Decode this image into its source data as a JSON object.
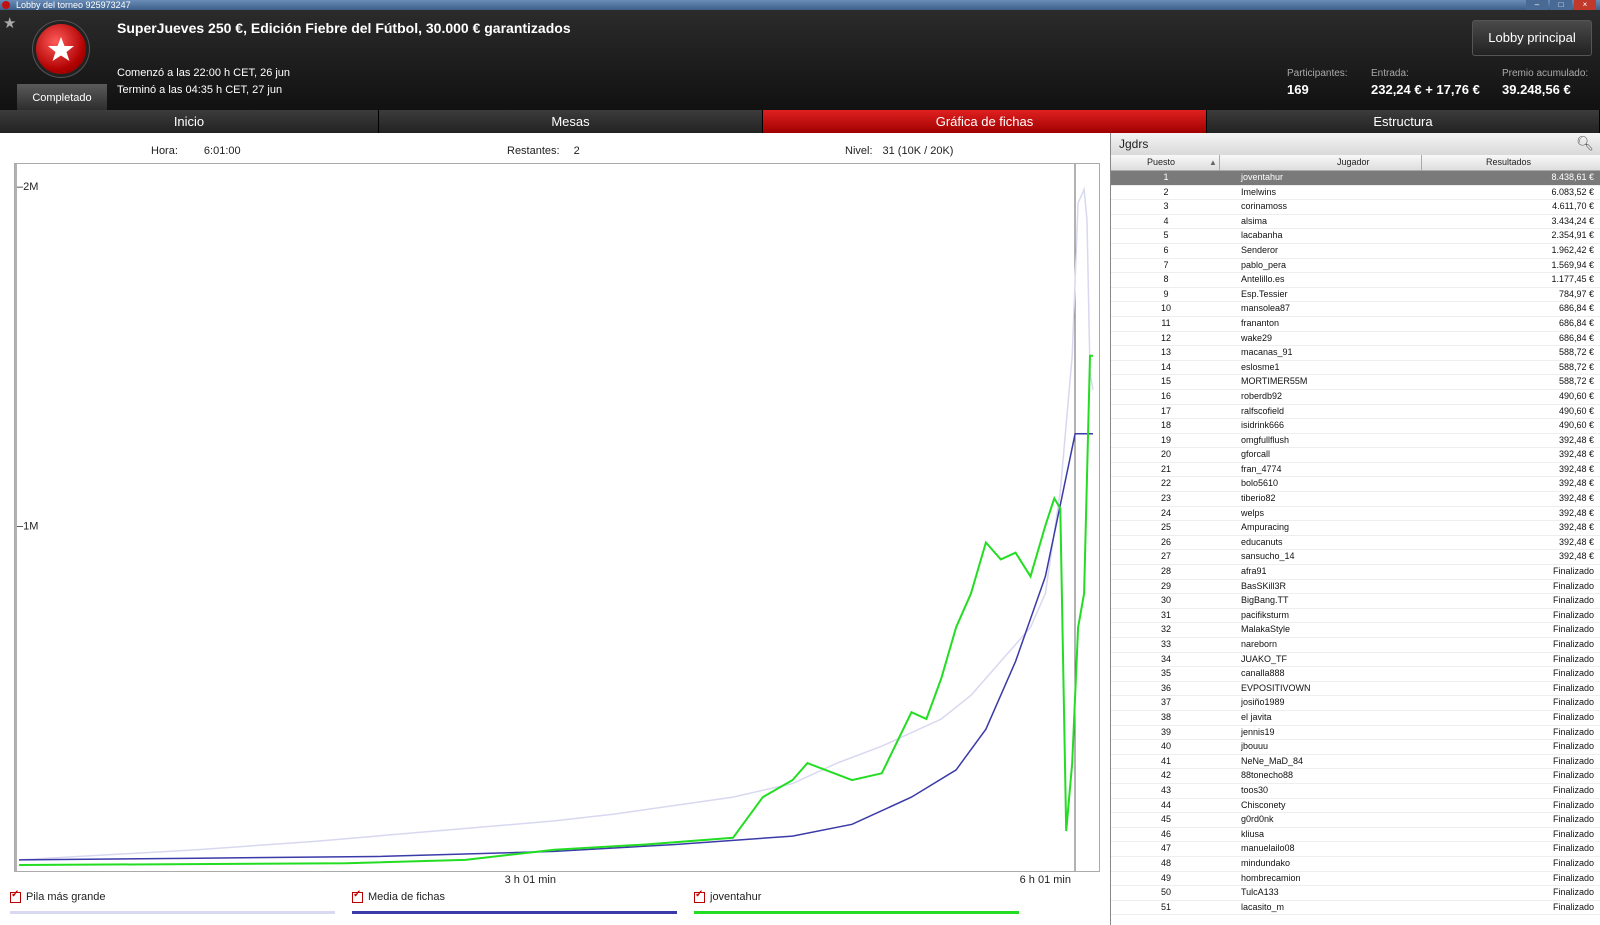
{
  "window": {
    "title": "Lobby del torneo 925973247"
  },
  "header": {
    "title": "SuperJueves 250 €, Edición Fiebre del Fútbol, 30.000 € garantizados",
    "status_badge": "Completado",
    "started": "Comenzó a las 22:00 h CET, 26 jun",
    "ended": "Terminó a las 04:35 h CET, 27 jun",
    "lobby_button": "Lobby principal",
    "participants_label": "Participantes:",
    "participants_value": "169",
    "entry_label": "Entrada:",
    "entry_value": "232,24 € + 17,76 €",
    "prize_label": "Premio acumulado:",
    "prize_value": "39.248,56 €"
  },
  "tabs": [
    {
      "label": "Inicio"
    },
    {
      "label": "Mesas"
    },
    {
      "label": "Gráfica de fichas"
    },
    {
      "label": "Estructura"
    }
  ],
  "chart_info": {
    "time_label": "Hora:",
    "time_value": "6:01:00",
    "remaining_label": "Restantes:",
    "remaining_value": "2",
    "level_label": "Nivel:",
    "level_value": "31 (10K / 20K)"
  },
  "chart_data": {
    "type": "line",
    "x_ticks": [
      "3 h 01 min",
      "6 h 01 min"
    ],
    "y_ticks": [
      "2M",
      "1M"
    ],
    "xlim_min": [
      0,
      361
    ],
    "ylim": [
      0,
      2000000
    ],
    "series": [
      {
        "name": "Pila más grande",
        "color": "#d8d8f0",
        "points": [
          [
            0,
            15000
          ],
          [
            30,
            30000
          ],
          [
            60,
            45000
          ],
          [
            100,
            70000
          ],
          [
            140,
            100000
          ],
          [
            180,
            130000
          ],
          [
            200,
            150000
          ],
          [
            240,
            200000
          ],
          [
            260,
            240000
          ],
          [
            275,
            300000
          ],
          [
            290,
            350000
          ],
          [
            310,
            430000
          ],
          [
            320,
            500000
          ],
          [
            330,
            600000
          ],
          [
            340,
            700000
          ],
          [
            345,
            800000
          ],
          [
            350,
            1100000
          ],
          [
            354,
            1500000
          ],
          [
            356,
            1950000
          ],
          [
            358,
            1990000
          ],
          [
            359,
            1900000
          ],
          [
            360,
            1450000
          ],
          [
            361,
            1400000
          ]
        ]
      },
      {
        "name": "Media de fichas",
        "color": "#3a3aa8",
        "points": [
          [
            0,
            15000
          ],
          [
            60,
            20000
          ],
          [
            120,
            25000
          ],
          [
            180,
            40000
          ],
          [
            220,
            60000
          ],
          [
            260,
            85000
          ],
          [
            280,
            120000
          ],
          [
            300,
            200000
          ],
          [
            315,
            280000
          ],
          [
            325,
            400000
          ],
          [
            335,
            600000
          ],
          [
            345,
            850000
          ],
          [
            355,
            1270000
          ],
          [
            361,
            1270000
          ]
        ]
      },
      {
        "name": "joventahur",
        "color": "#22dd22",
        "points": [
          [
            0,
            0
          ],
          [
            110,
            5000
          ],
          [
            150,
            15000
          ],
          [
            180,
            45000
          ],
          [
            210,
            60000
          ],
          [
            240,
            80000
          ],
          [
            250,
            200000
          ],
          [
            260,
            250000
          ],
          [
            265,
            300000
          ],
          [
            280,
            250000
          ],
          [
            290,
            270000
          ],
          [
            300,
            450000
          ],
          [
            305,
            430000
          ],
          [
            310,
            550000
          ],
          [
            315,
            700000
          ],
          [
            320,
            800000
          ],
          [
            325,
            950000
          ],
          [
            330,
            900000
          ],
          [
            335,
            920000
          ],
          [
            340,
            850000
          ],
          [
            345,
            1000000
          ],
          [
            348,
            1080000
          ],
          [
            350,
            1050000
          ],
          [
            352,
            100000
          ],
          [
            354,
            300000
          ],
          [
            356,
            700000
          ],
          [
            358,
            800000
          ],
          [
            360,
            1500000
          ],
          [
            361,
            1500000
          ]
        ]
      }
    ]
  },
  "legend": [
    {
      "label": "Pila más grande",
      "color": "#d8d8f0"
    },
    {
      "label": "Media de fichas",
      "color": "#3a3aa8"
    },
    {
      "label": "joventahur",
      "color": "#22dd22"
    }
  ],
  "players": {
    "panel_title": "Jgdrs",
    "col_pos": "Puesto",
    "col_player": "Jugador",
    "col_result": "Resultados",
    "rows": [
      {
        "pos": "1",
        "name": "joventahur",
        "res": "8.438,61 €"
      },
      {
        "pos": "2",
        "name": "Imelwins",
        "res": "6.083,52 €"
      },
      {
        "pos": "3",
        "name": "corinamoss",
        "res": "4.611,70 €"
      },
      {
        "pos": "4",
        "name": "alsima",
        "res": "3.434,24 €"
      },
      {
        "pos": "5",
        "name": "lacabanha",
        "res": "2.354,91 €"
      },
      {
        "pos": "6",
        "name": "Senderor",
        "res": "1.962,42 €"
      },
      {
        "pos": "7",
        "name": "pablo_pera",
        "res": "1.569,94 €"
      },
      {
        "pos": "8",
        "name": "Antelillo.es",
        "res": "1.177,45 €"
      },
      {
        "pos": "9",
        "name": "Esp.Tessier",
        "res": "784,97 €"
      },
      {
        "pos": "10",
        "name": "mansolea87",
        "res": "686,84 €"
      },
      {
        "pos": "11",
        "name": "frananton",
        "res": "686,84 €"
      },
      {
        "pos": "12",
        "name": "wake29",
        "res": "686,84 €"
      },
      {
        "pos": "13",
        "name": "macanas_91",
        "res": "588,72 €"
      },
      {
        "pos": "14",
        "name": "eslosme1",
        "res": "588,72 €"
      },
      {
        "pos": "15",
        "name": "MORTIMER55M",
        "res": "588,72 €"
      },
      {
        "pos": "16",
        "name": "roberdb92",
        "res": "490,60 €"
      },
      {
        "pos": "17",
        "name": "ralfscofield",
        "res": "490,60 €"
      },
      {
        "pos": "18",
        "name": "isidrink666",
        "res": "490,60 €"
      },
      {
        "pos": "19",
        "name": "omgfullflush",
        "res": "392,48 €"
      },
      {
        "pos": "20",
        "name": "gforcall",
        "res": "392,48 €"
      },
      {
        "pos": "21",
        "name": "fran_4774",
        "res": "392,48 €"
      },
      {
        "pos": "22",
        "name": "bolo5610",
        "res": "392,48 €"
      },
      {
        "pos": "23",
        "name": "tiberio82",
        "res": "392,48 €"
      },
      {
        "pos": "24",
        "name": "welps",
        "res": "392,48 €"
      },
      {
        "pos": "25",
        "name": "Ampuracing",
        "res": "392,48 €"
      },
      {
        "pos": "26",
        "name": "educanuts",
        "res": "392,48 €"
      },
      {
        "pos": "27",
        "name": "sansucho_14",
        "res": "392,48 €"
      },
      {
        "pos": "28",
        "name": "afra91",
        "res": "Finalizado"
      },
      {
        "pos": "29",
        "name": "BasSKill3R",
        "res": "Finalizado"
      },
      {
        "pos": "30",
        "name": "BigBang.TT",
        "res": "Finalizado"
      },
      {
        "pos": "31",
        "name": "pacifiksturm",
        "res": "Finalizado"
      },
      {
        "pos": "32",
        "name": "MalakaStyle",
        "res": "Finalizado"
      },
      {
        "pos": "33",
        "name": "nareborn",
        "res": "Finalizado"
      },
      {
        "pos": "34",
        "name": "JUAKO_TF",
        "res": "Finalizado"
      },
      {
        "pos": "35",
        "name": "canalla888",
        "res": "Finalizado"
      },
      {
        "pos": "36",
        "name": "EVPOSITIVOWN",
        "res": "Finalizado"
      },
      {
        "pos": "37",
        "name": "josiño1989",
        "res": "Finalizado"
      },
      {
        "pos": "38",
        "name": "el javita",
        "res": "Finalizado"
      },
      {
        "pos": "39",
        "name": "jennis19",
        "res": "Finalizado"
      },
      {
        "pos": "40",
        "name": "jbouuu",
        "res": "Finalizado"
      },
      {
        "pos": "41",
        "name": "NeNe_MaD_84",
        "res": "Finalizado"
      },
      {
        "pos": "42",
        "name": "88tonecho88",
        "res": "Finalizado"
      },
      {
        "pos": "43",
        "name": "toos30",
        "res": "Finalizado"
      },
      {
        "pos": "44",
        "name": "Chisconety",
        "res": "Finalizado"
      },
      {
        "pos": "45",
        "name": "g0rd0nk",
        "res": "Finalizado"
      },
      {
        "pos": "46",
        "name": "kliusa",
        "res": "Finalizado"
      },
      {
        "pos": "47",
        "name": "manuelailo08",
        "res": "Finalizado"
      },
      {
        "pos": "48",
        "name": "mindundako",
        "res": "Finalizado"
      },
      {
        "pos": "49",
        "name": "hombrecamion",
        "res": "Finalizado"
      },
      {
        "pos": "50",
        "name": "TulcA133",
        "res": "Finalizado"
      },
      {
        "pos": "51",
        "name": "lacasito_m",
        "res": "Finalizado"
      }
    ]
  }
}
